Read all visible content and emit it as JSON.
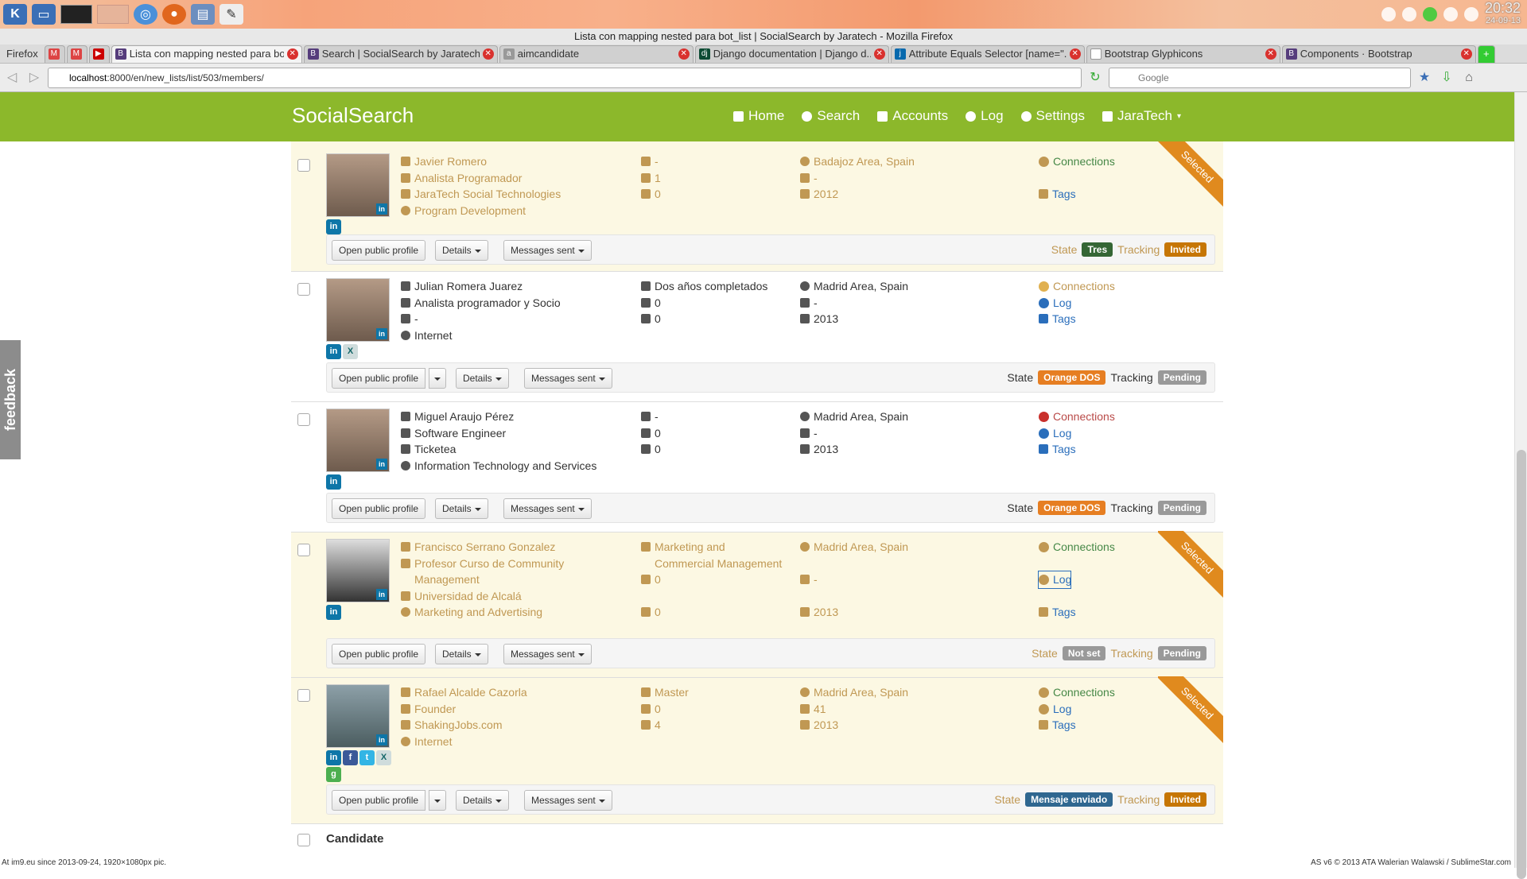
{
  "taskbar": {
    "clock_time": "20:32",
    "clock_date": "24-09-13"
  },
  "window_title": "Lista con mapping nested para bot_list | SocialSearch by Jaratech - Mozilla Firefox",
  "firefox_menu": "Firefox",
  "tabs": [
    {
      "label": "Lista con mapping nested para bo...",
      "active": true,
      "fav": "B"
    },
    {
      "label": "Search | SocialSearch by Jaratech",
      "active": false,
      "fav": "B"
    },
    {
      "label": "aimcandidate",
      "active": false,
      "fav": "a"
    },
    {
      "label": "Django documentation | Django d...",
      "active": false,
      "fav": "dj"
    },
    {
      "label": "Attribute Equals Selector [name=\"...",
      "active": false,
      "fav": "j"
    },
    {
      "label": "Bootstrap Glyphicons",
      "active": false,
      "fav": "B"
    },
    {
      "label": "Components · Bootstrap",
      "active": false,
      "fav": "B"
    }
  ],
  "url_host": "localhost",
  "url_rest": ":8000/en/new_lists/list/503/members/",
  "search_placeholder": "Google",
  "site": {
    "brand": "SocialSearch",
    "menu": [
      "Home",
      "Search",
      "Accounts",
      "Log",
      "Settings",
      "JaraTech"
    ]
  },
  "feedback": "feedback",
  "buttons": {
    "open": "Open public profile",
    "details": "Details",
    "messages": "Messages sent",
    "state": "State",
    "tracking": "Tracking",
    "selected": "Selected"
  },
  "candidates": [
    {
      "name": "Javier Romero",
      "title": "Analista Programador",
      "company": "JaraTech Social Technologies",
      "industry": "Program Development",
      "education": "-",
      "c1": "1",
      "c2": "0",
      "location": "Badajoz Area, Spain",
      "age": "-",
      "year": "2012",
      "links": [
        "Connections",
        "Tags"
      ],
      "state": "Tres",
      "tracking": "Invited"
    },
    {
      "name": "Julian Romera Juarez",
      "title": "Analista programador y Socio",
      "company": "-",
      "industry": "Internet",
      "education": "Dos años completados",
      "c1": "0",
      "c2": "0",
      "location": "Madrid Area, Spain",
      "age": "-",
      "year": "2013",
      "links": [
        "Connections",
        "Log",
        "Tags"
      ],
      "state": "Orange DOS",
      "tracking": "Pending"
    },
    {
      "name": "Miguel Araujo Pérez",
      "title": "Software Engineer",
      "company": "Ticketea",
      "industry": "Information Technology and Services",
      "education": "-",
      "c1": "0",
      "c2": "0",
      "location": "Madrid Area, Spain",
      "age": "-",
      "year": "2013",
      "links": [
        "Connections",
        "Log",
        "Tags"
      ],
      "state": "Orange DOS",
      "tracking": "Pending"
    },
    {
      "name": "Francisco Serrano Gonzalez",
      "title": "Profesor Curso de Community Management",
      "company": "Universidad de Alcalá",
      "industry": "Marketing and Advertising",
      "education": "Marketing and Commercial Management",
      "c1": "0",
      "c2": "0",
      "location": "Madrid Area, Spain",
      "age": "-",
      "year": "2013",
      "links": [
        "Connections",
        "Log",
        "Tags"
      ],
      "state": "Not set",
      "tracking": "Pending"
    },
    {
      "name": "Rafael Alcalde Cazorla",
      "title": "Founder",
      "company": "ShakingJobs.com",
      "industry": "Internet",
      "education": "Master",
      "c1": "0",
      "c2": "4",
      "location": "Madrid Area, Spain",
      "age": "41",
      "year": "2013",
      "links": [
        "Connections",
        "Log",
        "Tags"
      ],
      "state": "Mensaje enviado",
      "tracking": "Invited"
    }
  ],
  "bottom_title": "Candidate",
  "status_left": "At im9.eu since 2013-09-24, 1920×1080px pic.",
  "status_right": "AS v6 © 2013 ATA Walerian Walawski / SublimeStar.com"
}
